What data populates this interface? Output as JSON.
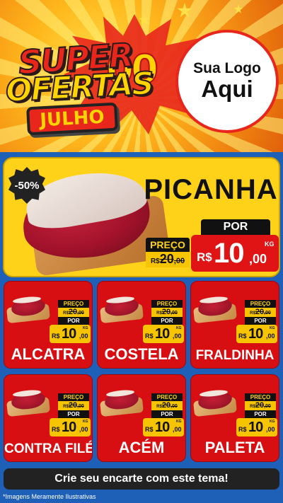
{
  "header": {
    "title_line1": "SUPER",
    "title_line2": "OFERTAS",
    "month_badge": "JULHO",
    "decor_zeros": "00",
    "logo_placeholder_line1": "Sua Logo",
    "logo_placeholder_line2": "Aqui"
  },
  "featured": {
    "discount": "-50%",
    "name": "PICANHA",
    "old_price_label": "PREÇO",
    "old_price_currency": "R$",
    "old_price_int": "20",
    "old_price_cents": ",00",
    "new_price_label": "POR",
    "new_price_currency": "R$",
    "new_price_int": "10",
    "new_price_cents": ",00",
    "unit": "KG"
  },
  "products": [
    {
      "name": "ALCATRA",
      "old_label": "PREÇO",
      "old_currency": "R$",
      "old_int": "20",
      "old_cents": ",00",
      "new_label": "POR",
      "currency": "R$",
      "price_int": "10",
      "price_cents": ",00",
      "unit": "KG"
    },
    {
      "name": "COSTELA",
      "old_label": "PREÇO",
      "old_currency": "R$",
      "old_int": "20",
      "old_cents": ",00",
      "new_label": "POR",
      "currency": "R$",
      "price_int": "10",
      "price_cents": ",00",
      "unit": "KG"
    },
    {
      "name": "FRALDINHA",
      "old_label": "PREÇO",
      "old_currency": "R$",
      "old_int": "20",
      "old_cents": ",00",
      "new_label": "POR",
      "currency": "R$",
      "price_int": "10",
      "price_cents": ",00",
      "unit": "KG"
    },
    {
      "name": "CONTRA FILÉ",
      "old_label": "PREÇO",
      "old_currency": "R$",
      "old_int": "20",
      "old_cents": ",00",
      "new_label": "POR",
      "currency": "R$",
      "price_int": "10",
      "price_cents": ",00",
      "unit": "KG"
    },
    {
      "name": "ACÉM",
      "old_label": "PREÇO",
      "old_currency": "R$",
      "old_int": "20",
      "old_cents": ",00",
      "new_label": "POR",
      "currency": "R$",
      "price_int": "10",
      "price_cents": ",00",
      "unit": "KG"
    },
    {
      "name": "PALETA",
      "old_label": "PREÇO",
      "old_currency": "R$",
      "old_int": "20",
      "old_cents": ",00",
      "new_label": "POR",
      "currency": "R$",
      "price_int": "10",
      "price_cents": ",00",
      "unit": "KG"
    }
  ],
  "footer": {
    "cta_label": "Crie seu encarte com este tema!",
    "disclaimer": "*Imagens Meramente Ilustrativas"
  },
  "colors": {
    "background": "#1e5fb8",
    "card_red": "#d80f12",
    "featured_yellow": "#ffd21a",
    "price_yellow": "#f7c400",
    "dark": "#111111"
  }
}
